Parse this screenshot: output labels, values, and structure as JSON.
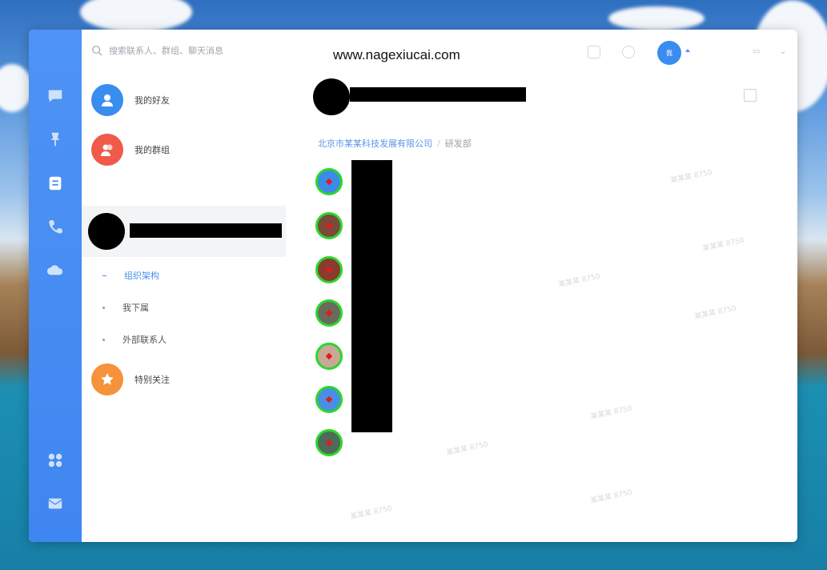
{
  "watermark_url": "www.nagexiucai.com",
  "search": {
    "placeholder": "搜索联系人、群组、聊天消息"
  },
  "account": {
    "avatar_text": "我"
  },
  "sidebar": {
    "nav_icons": [
      "chat-icon",
      "pin-icon",
      "contacts-icon",
      "phone-icon",
      "cloud-icon",
      "apps-icon",
      "mail-icon"
    ],
    "rows": [
      {
        "label": "我的好友",
        "color": "#3a8df0",
        "icon": "user-icon"
      },
      {
        "label": "我的群组",
        "color": "#ef5a4a",
        "icon": "group-icon"
      }
    ],
    "sub_items": [
      {
        "label": "组织架构",
        "active": true
      },
      {
        "label": "我下属",
        "active": false
      },
      {
        "label": "外部联系人",
        "active": false
      }
    ],
    "starred": {
      "label": "特别关注",
      "color": "#f5923a",
      "icon": "star-icon"
    }
  },
  "main": {
    "breadcrumb": {
      "org": "北京市某某科技发展有限公司",
      "dept": "研发部"
    },
    "members": [
      {
        "avatar_bg": "#3d8be8"
      },
      {
        "avatar_bg": "#7a4a3a"
      },
      {
        "avatar_bg": "#8a3b2e"
      },
      {
        "avatar_bg": "#6a6a5a"
      },
      {
        "avatar_bg": "#c9a899"
      },
      {
        "avatar_bg": "#4a8fe6"
      },
      {
        "avatar_bg": "#4e6a5a"
      }
    ],
    "watermark_text": "某某某 8750"
  }
}
